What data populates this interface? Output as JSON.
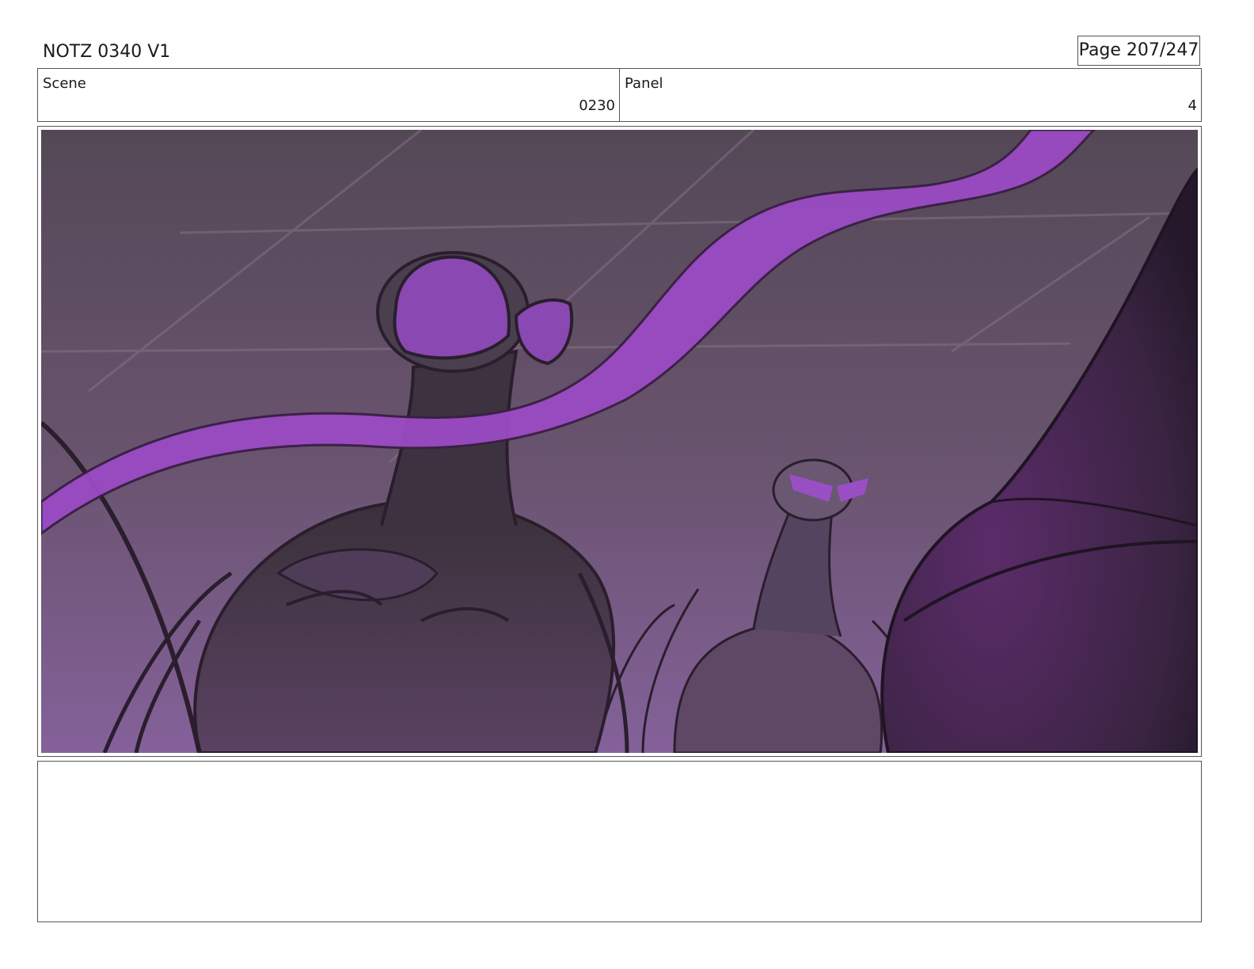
{
  "header": {
    "title": "NOTZ 0340 V1",
    "page": "Page 207/247"
  },
  "info": {
    "scene_label": "Scene",
    "scene_value": "0230",
    "panel_label": "Panel",
    "panel_value": "4"
  },
  "panel": {
    "colors": {
      "sky_top": "#544856",
      "sky_bottom": "#84619a",
      "ribbon": "#9a4bc4",
      "eye_glow": "#9a4ec4",
      "creature_dark": "#2f2732",
      "creature_mid": "#4d3a55",
      "foreground_dark": "#2a1a2f"
    }
  },
  "notes": {
    "text": ""
  }
}
